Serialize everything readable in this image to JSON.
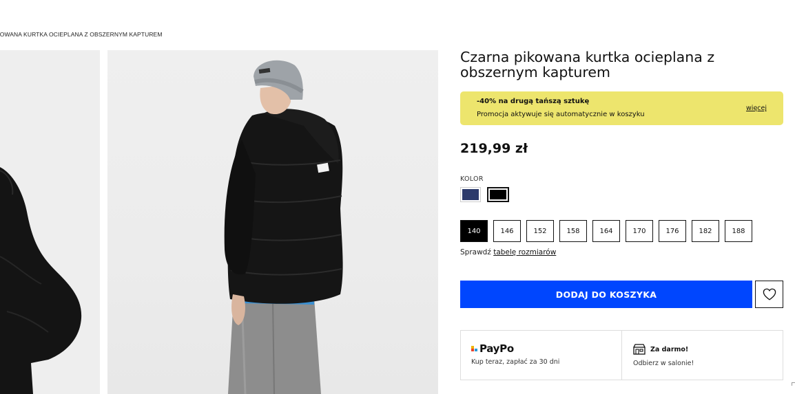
{
  "breadcrumb": "KOWANA KURTKA OCIEPLANA Z OBSZERNYM KAPTUREM",
  "product": {
    "title": "Czarna pikowana kurtka ocieplana z obszernym kapturem",
    "price": "219,99 zł"
  },
  "promo": {
    "title": "-40% na drugą tańszą sztukę",
    "subtitle": "Promocja aktywuje się automatycznie w koszyku",
    "more_link": "więcej",
    "background": "#ede56d"
  },
  "color": {
    "label": "KOLOR",
    "swatches": [
      "#2c3a6b",
      "#000000"
    ],
    "selected": 1
  },
  "sizes": {
    "options": [
      "140",
      "146",
      "152",
      "158",
      "164",
      "170",
      "176",
      "182",
      "188"
    ],
    "selected": "140",
    "check_prefix": "Sprawdź",
    "check_link": "tabelę rozmiarów"
  },
  "actions": {
    "add_to_cart": "DODAJ DO KOSZYKA",
    "accent": "#0046fe",
    "wishlist_icon": "heart-icon"
  },
  "info": {
    "paypo_logo": "PayPo",
    "paypo_sub": "Kup teraz, zapłać za 30 dni",
    "store_title": "Za darmo!",
    "store_sub": "Odbierz w salonie!",
    "store_icon": "store-icon"
  }
}
